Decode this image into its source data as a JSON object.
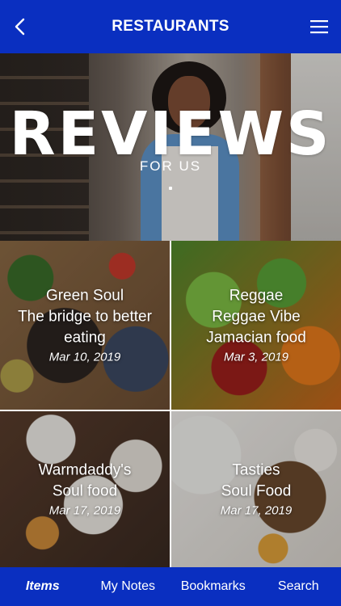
{
  "header": {
    "title": "RESTAURANTS",
    "back_icon": "chevron-left-icon",
    "menu_icon": "hamburger-menu-icon"
  },
  "hero": {
    "title": "REVIEWS",
    "subtitle": "FOR US"
  },
  "restaurants": [
    {
      "lines": [
        "Green Soul",
        "The bridge to better",
        "eating"
      ],
      "date": "Mar 10, 2019"
    },
    {
      "lines": [
        "Reggae",
        "Reggae Vibe",
        "Jamacian food"
      ],
      "date": "Mar 3, 2019"
    },
    {
      "lines": [
        "Warmdaddy's",
        "Soul food"
      ],
      "date": "Mar 17, 2019"
    },
    {
      "lines": [
        "Tasties",
        "Soul Food"
      ],
      "date": "Mar 17, 2019"
    }
  ],
  "tabbar": {
    "tabs": [
      {
        "label": "Items",
        "active": true
      },
      {
        "label": "My Notes",
        "active": false
      },
      {
        "label": "Bookmarks",
        "active": false
      },
      {
        "label": "Search",
        "active": false
      }
    ]
  },
  "colors": {
    "primary": "#0a2fc0",
    "text_on_primary": "#ffffff"
  }
}
